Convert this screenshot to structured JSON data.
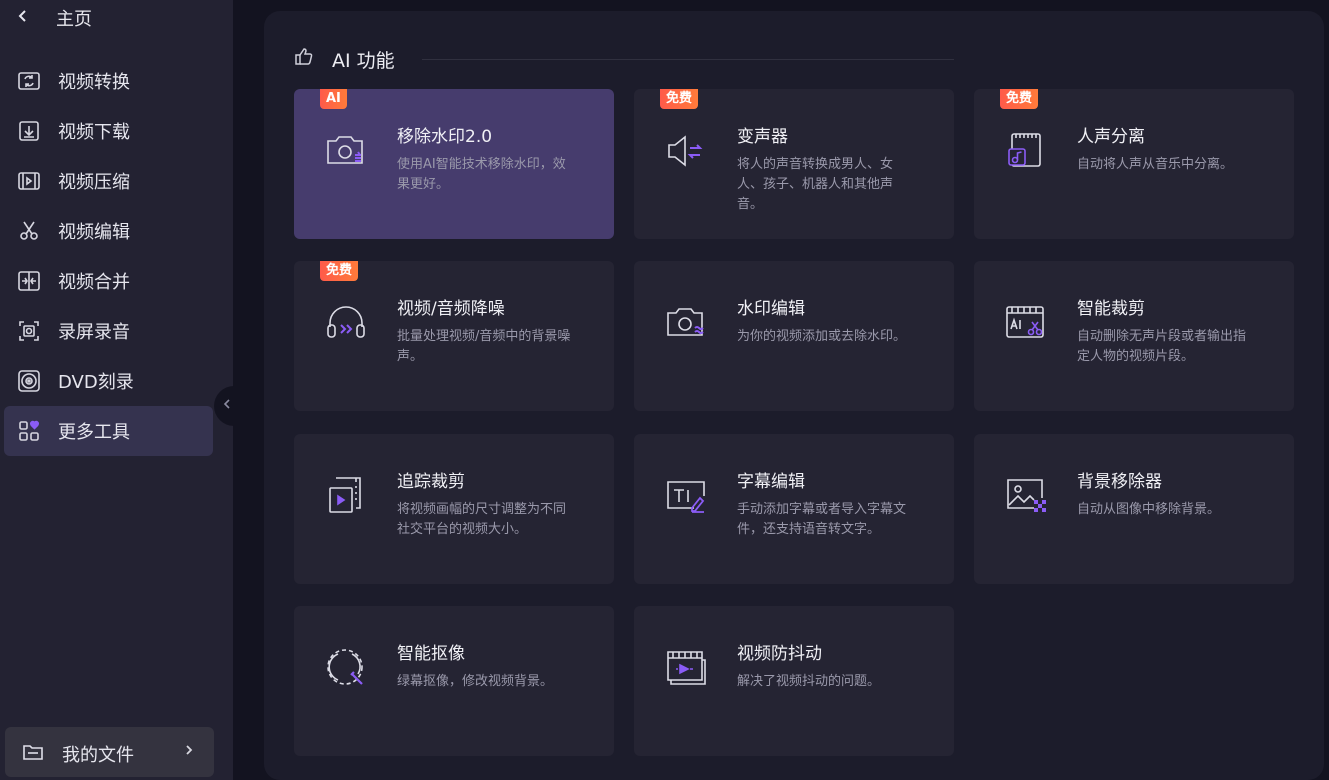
{
  "sidebar": {
    "home_label": "主页",
    "items": [
      {
        "label": "视频转换",
        "icon": "convert-icon"
      },
      {
        "label": "视频下载",
        "icon": "download-icon"
      },
      {
        "label": "视频压缩",
        "icon": "compress-icon"
      },
      {
        "label": "视频编辑",
        "icon": "scissors-icon"
      },
      {
        "label": "视频合并",
        "icon": "merge-icon"
      },
      {
        "label": "录屏录音",
        "icon": "record-screen-icon"
      },
      {
        "label": "DVD刻录",
        "icon": "disc-icon"
      },
      {
        "label": "更多工具",
        "icon": "more-tools-icon",
        "active": true
      }
    ],
    "my_files_label": "我的文件"
  },
  "section": {
    "title": "AI 功能"
  },
  "cards": [
    {
      "title": "移除水印2.0",
      "desc": "使用AI智能技术移除水印，效果更好。",
      "badge": "AI",
      "icon": "watermark-camera-icon",
      "highlight": true
    },
    {
      "title": "变声器",
      "desc": "将人的声音转换成男人、女人、孩子、机器人和其他声音。",
      "badge": "免费",
      "icon": "speaker-swap-icon"
    },
    {
      "title": "人声分离",
      "desc": "自动将人声从音乐中分离。",
      "badge": "免费",
      "icon": "vocal-separate-icon"
    },
    {
      "title": "视频/音频降噪",
      "desc": "批量处理视频/音频中的背景噪声。",
      "badge": "免费",
      "icon": "headphones-icon"
    },
    {
      "title": "水印编辑",
      "desc": "为你的视频添加或去除水印。",
      "badge": "",
      "icon": "watermark-edit-icon"
    },
    {
      "title": "智能裁剪",
      "desc": "自动删除无声片段或者输出指定人物的视频片段。",
      "badge": "",
      "icon": "ai-cut-icon"
    },
    {
      "title": "追踪裁剪",
      "desc": "将视频画幅的尺寸调整为不同社交平台的视频大小。",
      "badge": "",
      "icon": "track-crop-icon"
    },
    {
      "title": "字幕编辑",
      "desc": "手动添加字幕或者导入字幕文件，还支持语音转文字。",
      "badge": "",
      "icon": "subtitle-icon"
    },
    {
      "title": "背景移除器",
      "desc": "自动从图像中移除背景。",
      "badge": "",
      "icon": "image-bg-remove-icon"
    },
    {
      "title": "智能抠像",
      "desc": "绿幕抠像，修改视频背景。",
      "badge": "",
      "icon": "matting-icon"
    },
    {
      "title": "视频防抖动",
      "desc": "解决了视频抖动的问题。",
      "badge": "",
      "icon": "stabilize-icon"
    }
  ],
  "colors": {
    "accent": "#8b5cf6",
    "badge_start": "#ff5a4a",
    "badge_end": "#ff7b3a",
    "active_nav": "#35334f",
    "highlight_card": "#463c6d"
  }
}
